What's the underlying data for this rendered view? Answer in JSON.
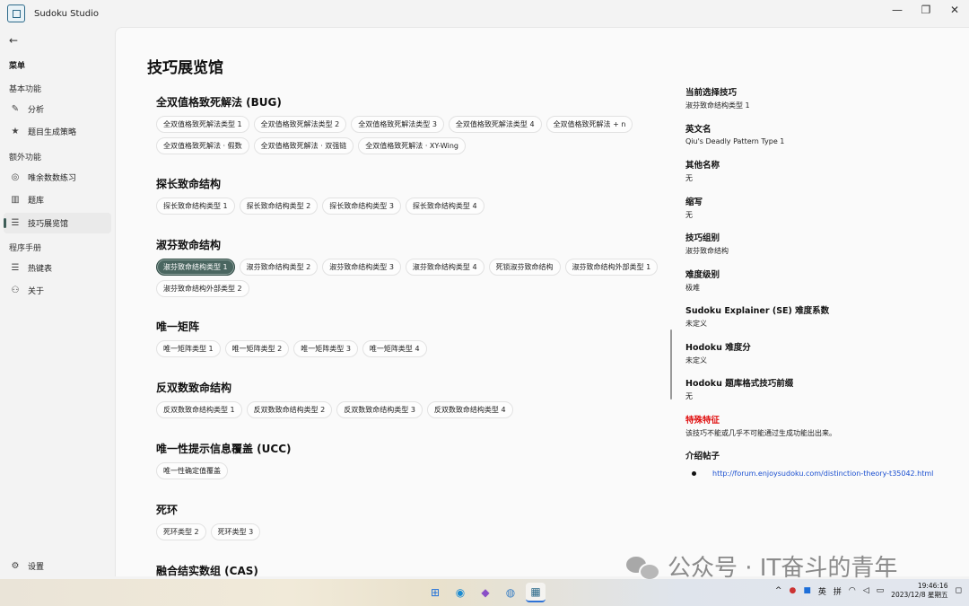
{
  "window": {
    "title": "Sudoku Studio",
    "buttons": {
      "minimize": "—",
      "maximize": "❐",
      "close": "✕"
    }
  },
  "sidebar": {
    "back": "←",
    "menu_label": "菜单",
    "sections": [
      {
        "header": "基本功能",
        "items": [
          {
            "label": "分析",
            "icon": "pencil-icon",
            "glyph": "✎"
          },
          {
            "label": "题目生成策略",
            "icon": "star-icon",
            "glyph": "★"
          }
        ]
      },
      {
        "header": "额外功能",
        "items": [
          {
            "label": "唯余数数练习",
            "icon": "gamepad-icon",
            "glyph": "◎"
          },
          {
            "label": "题库",
            "icon": "library-icon",
            "glyph": "▥"
          },
          {
            "label": "技巧展览馆",
            "icon": "list-icon",
            "glyph": "☰",
            "active": true
          }
        ]
      },
      {
        "header": "程序手册",
        "items": [
          {
            "label": "热键表",
            "icon": "list-icon",
            "glyph": "☰"
          },
          {
            "label": "关于",
            "icon": "people-icon",
            "glyph": "⚇"
          }
        ]
      }
    ],
    "settings": {
      "label": "设置",
      "glyph": "⚙"
    }
  },
  "main": {
    "page_title": "技巧展览馆",
    "groups": [
      {
        "title": "全双值格致死解法 (BUG)",
        "chips": [
          "全双值格致死解法类型 1",
          "全双值格致死解法类型 2",
          "全双值格致死解法类型 3",
          "全双值格致死解法类型 4",
          "全双值格致死解法 + n",
          "全双值格致死解法 · 假数",
          "全双值格致死解法 · 双强链",
          "全双值格致死解法 · XY-Wing"
        ]
      },
      {
        "title": "探长致命结构",
        "chips": [
          "探长致命结构类型 1",
          "探长致命结构类型 2",
          "探长致命结构类型 3",
          "探长致命结构类型 4"
        ]
      },
      {
        "title": "淑芬致命结构",
        "chips": [
          "淑芬致命结构类型 1",
          "淑芬致命结构类型 2",
          "淑芬致命结构类型 3",
          "淑芬致命结构类型 4",
          "死锁淑芬致命结构",
          "淑芬致命结构外部类型 1",
          "淑芬致命结构外部类型 2"
        ],
        "selected": 0
      },
      {
        "title": "唯一矩阵",
        "chips": [
          "唯一矩阵类型 1",
          "唯一矩阵类型 2",
          "唯一矩阵类型 3",
          "唯一矩阵类型 4"
        ]
      },
      {
        "title": "反双数致命结构",
        "chips": [
          "反双数致命结构类型 1",
          "反双数致命结构类型 2",
          "反双数致命结构类型 3",
          "反双数致命结构类型 4"
        ]
      },
      {
        "title": "唯一性提示信息覆盖 (UCC)",
        "chips": [
          "唯一性确定值覆盖"
        ]
      },
      {
        "title": "死环",
        "chips": [
          "死环类型 2",
          "死环类型 3"
        ]
      },
      {
        "title": "融合结实数组 (CAS)",
        "chips": []
      }
    ]
  },
  "detail": {
    "fields": [
      {
        "label": "当前选择技巧",
        "value": "淑芬致命结构类型 1"
      },
      {
        "label": "英文名",
        "value": "Qiu's Deadly Pattern Type 1"
      },
      {
        "label": "其他名称",
        "value": "无"
      },
      {
        "label": "缩写",
        "value": "无"
      },
      {
        "label": "技巧组别",
        "value": "淑芬致命结构"
      },
      {
        "label": "难度级别",
        "value": "极难"
      },
      {
        "label": "Sudoku Explainer (SE) 难度系数",
        "value": "未定义"
      },
      {
        "label": "Hodoku 难度分",
        "value": "未定义"
      },
      {
        "label": "Hodoku 题库格式技巧前缀",
        "value": "无"
      },
      {
        "label": "特殊特征",
        "value": "该技巧不能或几乎不可能通过生成功能出出来。",
        "special": true
      }
    ],
    "intro_label": "介绍帖子",
    "intro_link": "http://forum.enjoysudoku.com/distinction-theory-t35042.html"
  },
  "watermark": "公众号 · IT奋斗的青年",
  "taskbar": {
    "tray": {
      "ime1": "英",
      "ime2": "拼",
      "time": "19:46:16",
      "date": "2023/12/8 星期五"
    }
  },
  "colors": {
    "accent": "#4a6660",
    "special": "#e01010",
    "link": "#1a4fd0"
  }
}
